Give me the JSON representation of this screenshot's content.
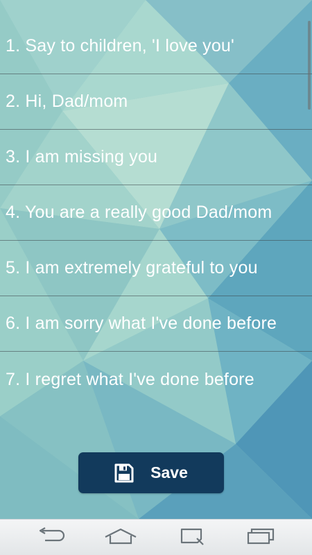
{
  "phrases": [
    {
      "label": "1. Say to children, 'I love you'"
    },
    {
      "label": "2. Hi, Dad/mom"
    },
    {
      "label": "3. I am missing you"
    },
    {
      "label": "4. You are a really good Dad/mom"
    },
    {
      "label": "5. I am extremely grateful to you"
    },
    {
      "label": "6. I am sorry what I've done before"
    },
    {
      "label": "7. I regret what I've done before"
    }
  ],
  "save_button": {
    "label": "Save",
    "icon": "floppy-disk-icon"
  },
  "nav_bar": {
    "buttons": [
      {
        "icon": "back-icon"
      },
      {
        "icon": "home-icon"
      },
      {
        "icon": "recent-apps-icon"
      },
      {
        "icon": "multi-window-icon"
      }
    ]
  },
  "colors": {
    "background_light": "#b7dcd4",
    "background_mid": "#7fbfc4",
    "background_dark": "#4e97b3",
    "save_button": "#123a5c",
    "divider": "#3c464b",
    "text": "#ffffff"
  }
}
